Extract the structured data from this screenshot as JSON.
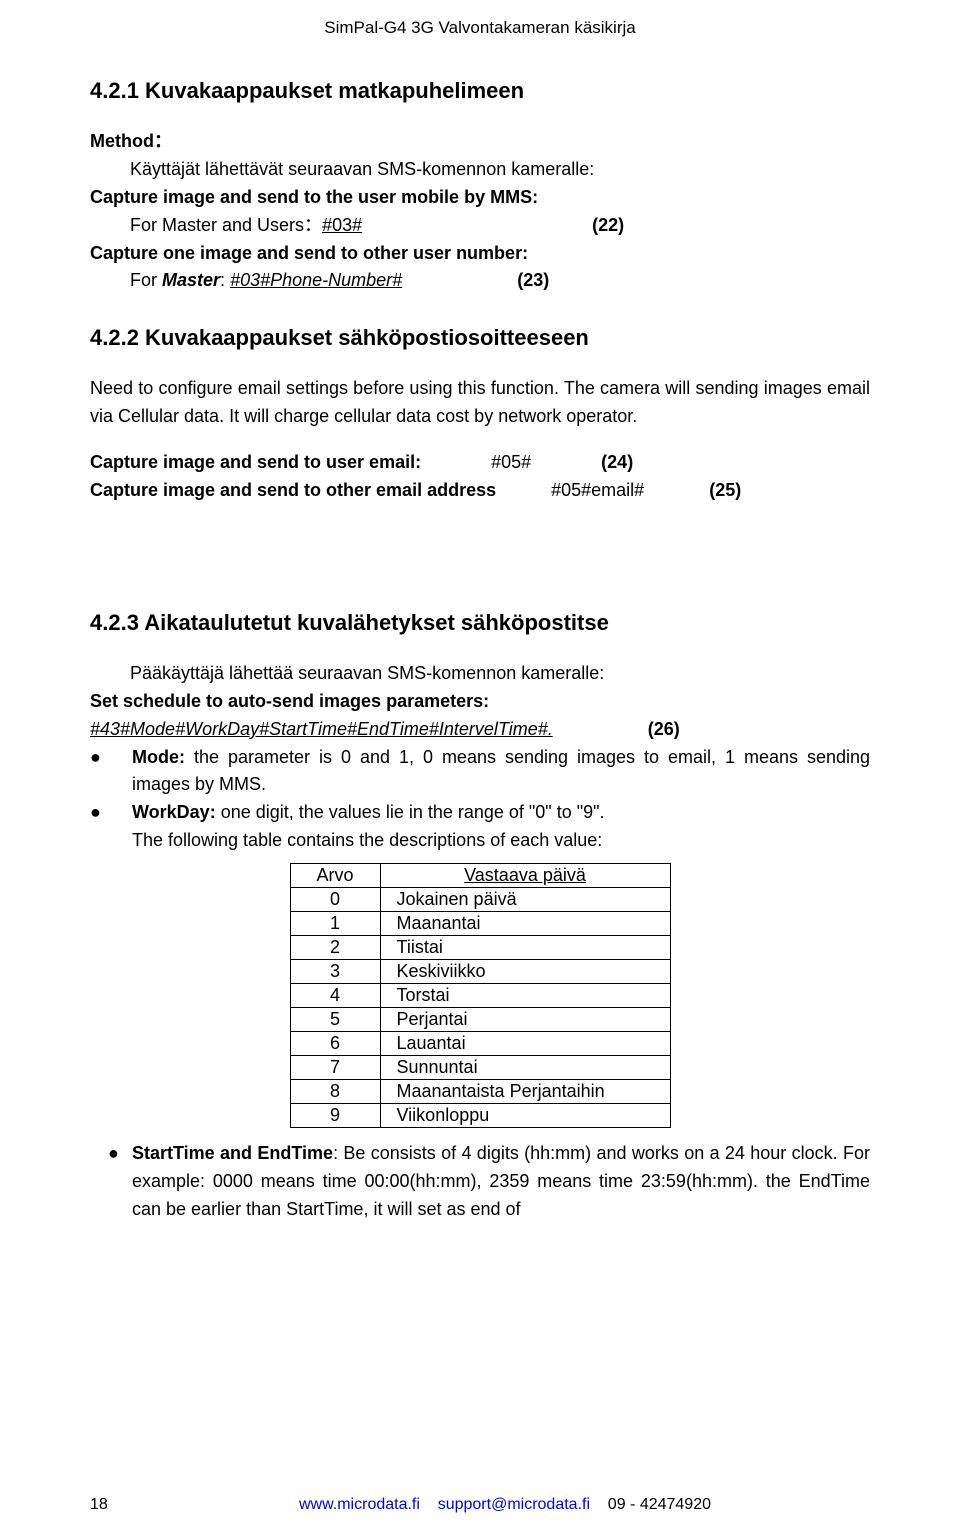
{
  "header": "SimPal-G4 3G Valvontakameran käsikirja",
  "s421": {
    "title": "4.2.1 Kuvakaappaukset matkapuhelimeen",
    "method_label": "Method：",
    "method_text": "Käyttäjät lähettävät seuraavan SMS-komennon kameralle:",
    "cap1_label": "Capture image and send to the user mobile by MMS:",
    "cap1_cmd_prefix": "For Master and Users：",
    "cap1_cmd": "#03#",
    "cap1_num": "(22)",
    "cap2_label": "Capture one image and send to other user number:",
    "cap2_prefix": "For ",
    "cap2_master": "Master",
    "cap2_colon": ": ",
    "cap2_cmd": "#03#Phone-Number#",
    "cap2_num": "(23)"
  },
  "s422": {
    "title": "4.2.2 Kuvakaappaukset sähköpostiosoitteeseen",
    "para": "Need to configure email settings before using this function. The camera will sending images email via Cellular data. It will charge cellular data cost by network operator.",
    "line1_label": "Capture image and send to user email:",
    "line1_cmd": "#05#",
    "line1_num": "(24)",
    "line2_label": "Capture image and send to other email address",
    "line2_cmd": "#05#email#",
    "line2_num": "(25)"
  },
  "s423": {
    "title": "4.2.3 Aikataulutetut kuvalähetykset sähköpostitse",
    "intro": "Pääkäyttäjä lähettää seuraavan SMS-komennon kameralle:",
    "set_label": "Set schedule to auto-send images parameters:",
    "cmd": "#43#Mode#WorkDay#StartTime#EndTime#IntervelTime#.",
    "cmd_num": "(26)",
    "mode_label": "Mode:",
    "mode_text": " the parameter is 0 and 1, 0 means sending images to email, 1 means sending images by MMS.",
    "workday_label": "WorkDay:",
    "workday_text": " one digit, the values lie in the range of \"0\" to \"9\".",
    "table_caption": "The following table contains the descriptions of each value:",
    "table_headers": [
      "Arvo",
      "Vastaava päivä"
    ],
    "table_rows": [
      [
        "0",
        "Jokainen päivä"
      ],
      [
        "1",
        "Maanantai"
      ],
      [
        "2",
        "Tiistai"
      ],
      [
        "3",
        "Keskiviikko"
      ],
      [
        "4",
        "Torstai"
      ],
      [
        "5",
        "Perjantai"
      ],
      [
        "6",
        "Lauantai"
      ],
      [
        "7",
        "Sunnuntai"
      ],
      [
        "8",
        "Maanantaista Perjantaihin"
      ],
      [
        "9",
        "Viikonloppu"
      ]
    ],
    "start_label": "StartTime and EndTime",
    "start_text": ": Be consists of 4 digits (hh:mm) and works on a 24 hour clock. For example: 0000 means time 00:00(hh:mm), 2359 means time 23:59(hh:mm). the EndTime can be earlier than StartTime, it will set as end of"
  },
  "footer": {
    "pagenum": "18",
    "url": "www.microdata.fi",
    "email": "support@microdata.fi",
    "phone": "09 - 42474920"
  }
}
